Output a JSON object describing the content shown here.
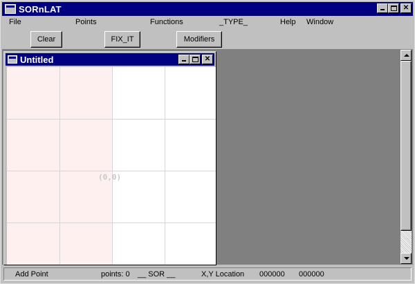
{
  "app": {
    "title": "SORnLAT"
  },
  "menubar": {
    "items": [
      "File",
      "Points",
      "Functions",
      "_TYPE_",
      "Help",
      "Window"
    ]
  },
  "toolbar": {
    "clear_label": "Clear",
    "fixit_label": "FIX_IT",
    "modifiers_label": "Modifiers"
  },
  "document": {
    "title": "Untitled",
    "origin_label": "(0,0)"
  },
  "statusbar": {
    "mode": "Add Point",
    "points": "points: 0",
    "sor_label": "__ SOR __",
    "xy_label": "X,Y Location",
    "x_value": "000000",
    "y_value": "000000"
  },
  "icons": {
    "minimize": "minimize-icon",
    "maximize": "maximize-icon",
    "close": "close-icon",
    "scroll_up": "scroll-up-arrow-icon",
    "scroll_down": "scroll-down-arrow-icon"
  },
  "colors": {
    "titlebar": "#000080",
    "face": "#c0c0c0",
    "mdi_background": "#808080",
    "canvas": "#ffffff",
    "canvas_shade": "#fff0f0",
    "grid": "#d6d6d6"
  }
}
